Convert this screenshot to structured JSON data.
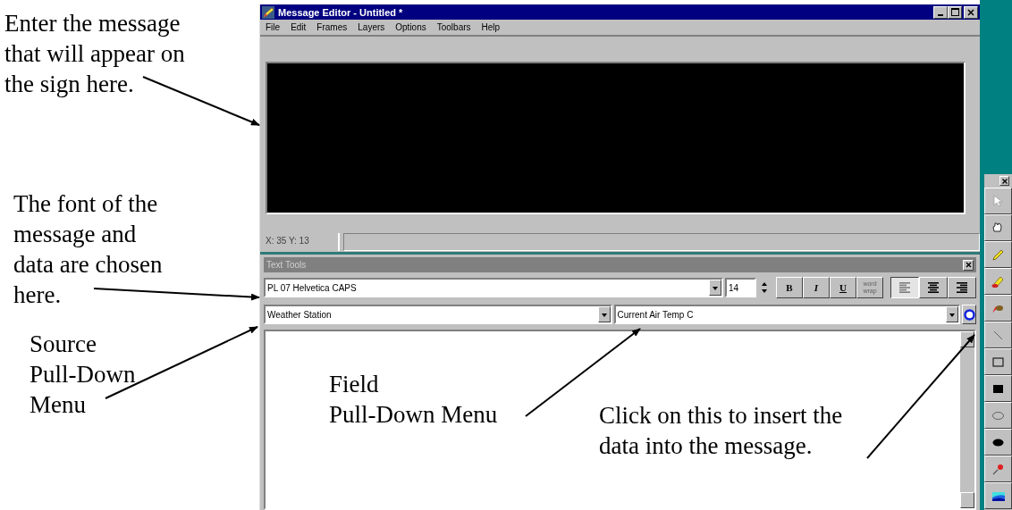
{
  "annotations": [
    {
      "text": "Enter the message\nthat will appear on\nthe sign here."
    },
    {
      "text": "The font of the\nmessage and\ndata are chosen\nhere."
    },
    {
      "text": "Source\nPull-Down\nMenu"
    },
    {
      "text": "Field\nPull-Down Menu"
    },
    {
      "text": "Click on this to insert the\ndata into the message."
    }
  ],
  "window": {
    "title": "Message Editor - Untitled *"
  },
  "menu": [
    "File",
    "Edit",
    "Frames",
    "Layers",
    "Options",
    "Toolbars",
    "Help"
  ],
  "status_bar": {
    "position": "X: 35 Y: 13"
  },
  "text_tools": {
    "title": "Text Tools",
    "font": "PL 07 Helvetica CAPS",
    "size": "14",
    "style_buttons": [
      {
        "label": "B"
      },
      {
        "label": "I"
      },
      {
        "label": "U"
      },
      {
        "label": "word wrap"
      }
    ],
    "alignment": [
      {
        "selected": true
      },
      {
        "selected": false
      },
      {
        "selected": false
      }
    ],
    "source": "Weather Station",
    "field": "Current Air Temp C"
  }
}
